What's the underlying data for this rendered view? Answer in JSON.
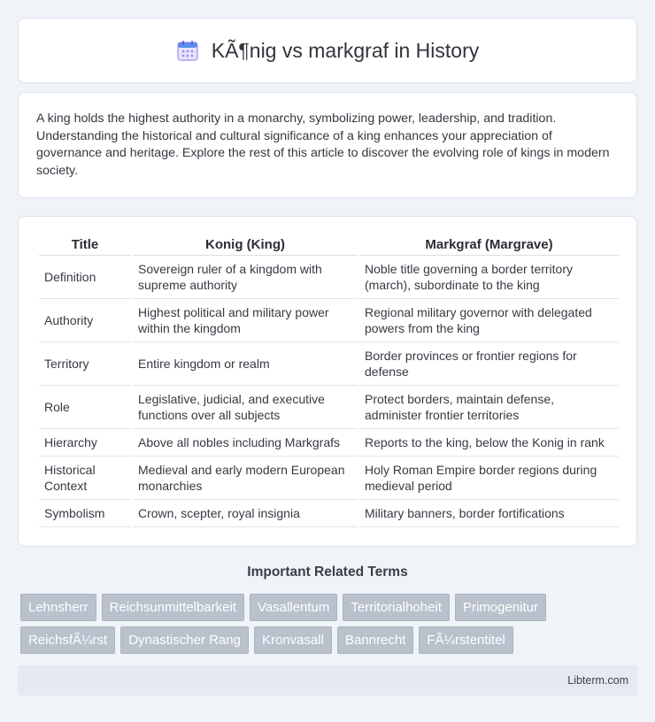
{
  "header": {
    "title": "KÃ¶nig vs markgraf in History",
    "icon": "calendar-icon"
  },
  "intro": {
    "text": "A king holds the highest authority in a monarchy, symbolizing power, leadership, and tradition. Understanding the historical and cultural significance of a king enhances your appreciation of governance and heritage. Explore the rest of this article to discover the evolving role of kings in modern society."
  },
  "comparison": {
    "headers": [
      "Title",
      "Konig (King)",
      "Markgraf (Margrave)"
    ],
    "rows": [
      [
        "Definition",
        "Sovereign ruler of a kingdom with supreme authority",
        "Noble title governing a border territory (march), subordinate to the king"
      ],
      [
        "Authority",
        "Highest political and military power within the kingdom",
        "Regional military governor with delegated powers from the king"
      ],
      [
        "Territory",
        "Entire kingdom or realm",
        "Border provinces or frontier regions for defense"
      ],
      [
        "Role",
        "Legislative, judicial, and executive functions over all subjects",
        "Protect borders, maintain defense, administer frontier territories"
      ],
      [
        "Hierarchy",
        "Above all nobles including Markgrafs",
        "Reports to the king, below the Konig in rank"
      ],
      [
        "Historical Context",
        "Medieval and early modern European monarchies",
        "Holy Roman Empire border regions during medieval period"
      ],
      [
        "Symbolism",
        "Crown, scepter, royal insignia",
        "Military banners, border fortifications"
      ]
    ]
  },
  "related": {
    "title": "Important Related Terms",
    "row1": [
      "Lehnsherr",
      "Reichsunmittelbarkeit",
      "Vasallentum",
      "Territorialhoheit",
      "Primogenitur"
    ],
    "row2": [
      "ReichsfÃ¼rst",
      "Dynastischer Rang",
      "Kronvasall",
      "Bannrecht",
      "FÃ¼rstentitel"
    ]
  },
  "footer": {
    "text": "Libterm.com"
  },
  "colors": {
    "background": "#f0f3f8",
    "tag": "#b9c1cd",
    "footer": "#e4e9f2"
  }
}
